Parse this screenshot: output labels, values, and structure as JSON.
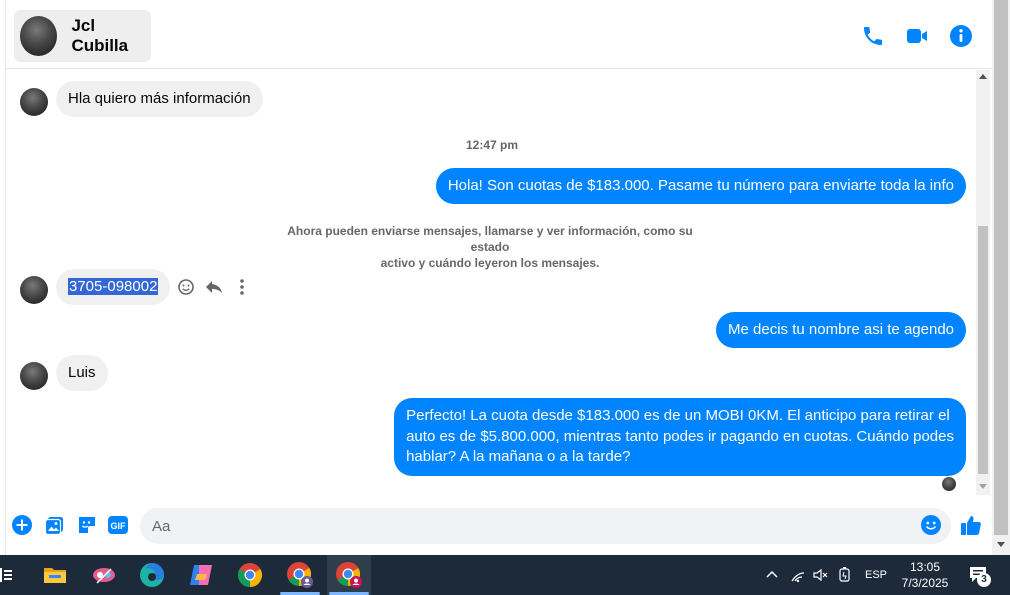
{
  "header": {
    "contact_name": "Jcl Cubilla",
    "actions": [
      {
        "icon": "phone-icon"
      },
      {
        "icon": "video-icon"
      },
      {
        "icon": "info-icon"
      }
    ]
  },
  "messages": [
    {
      "direction": "in",
      "text": "Hla quiero más información"
    },
    {
      "type": "timestamp",
      "text": "12:47 pm"
    },
    {
      "direction": "out",
      "text": "Hola! Son cuotas de $183.000. Pasame tu número para enviarte toda la info"
    },
    {
      "type": "notice",
      "line1": "Ahora pueden enviarse mensajes, llamarse y ver información, como su estado",
      "line2": "activo y cuándo leyeron los mensajes."
    },
    {
      "direction": "in",
      "text": "3705-098002",
      "selected": true
    },
    {
      "direction": "out",
      "text": "Me decis tu nombre asi te agendo"
    },
    {
      "direction": "in",
      "text": "Luis"
    },
    {
      "direction": "out",
      "line1": "Perfecto! La cuota desde $183.000 es de un MOBI 0KM. El anticipo para retirar el",
      "line2": "auto es de $5.800.000, mientras tanto podes ir pagando en cuotas. Cuándo podes",
      "line3": "hablar? A la mañana o a la tarde?"
    }
  ],
  "composer": {
    "placeholder": "Aa",
    "left_icons": [
      "add-icon",
      "photo-icon",
      "sticker-icon",
      "gif-icon"
    ],
    "gif_label": "GIF"
  },
  "taskbar": {
    "apps": [
      "file-explorer-icon",
      "snipping-tool-icon",
      "edge-icon",
      "copilot-icon",
      "chrome-icon",
      "chrome-profile-icon",
      "chrome-profile-active-icon"
    ],
    "language": "ESP",
    "time": "13:05",
    "date": "7/3/2025",
    "notification_count": "3"
  },
  "colors": {
    "accent": "#0084ff",
    "incoming_bubble": "#f0f0f0",
    "taskbar": "#1c2a3a"
  }
}
